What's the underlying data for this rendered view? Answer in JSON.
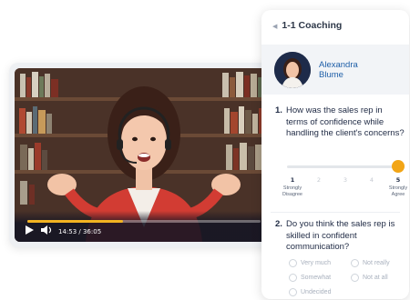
{
  "player": {
    "time": "14:53 / 36:05",
    "progress": 0.41,
    "colors": {
      "progress": "#f2b321"
    },
    "icons": [
      "play-icon",
      "volume-icon"
    ]
  },
  "panel": {
    "back_icon": "◀",
    "title": "1-1 Coaching",
    "coach": {
      "first": "Alexandra",
      "last": "Blume"
    },
    "q1": {
      "number": "1.",
      "text": "How was the sales rep in terms of confidence while handling the client's concerns?",
      "value": 5,
      "scale": [
        "1",
        "2",
        "3",
        "4",
        "5"
      ],
      "min_label": "Strongly Disagree",
      "max_label": "Strongly Agree"
    },
    "q2": {
      "number": "2.",
      "text": "Do you think the sales rep is skilled in confident communication?",
      "options": [
        "Very much",
        "Not really",
        "Somewhat",
        "Not at all",
        "Undecided"
      ]
    },
    "colors": {
      "accent": "#f2a516",
      "name": "#1f5fa8"
    }
  }
}
